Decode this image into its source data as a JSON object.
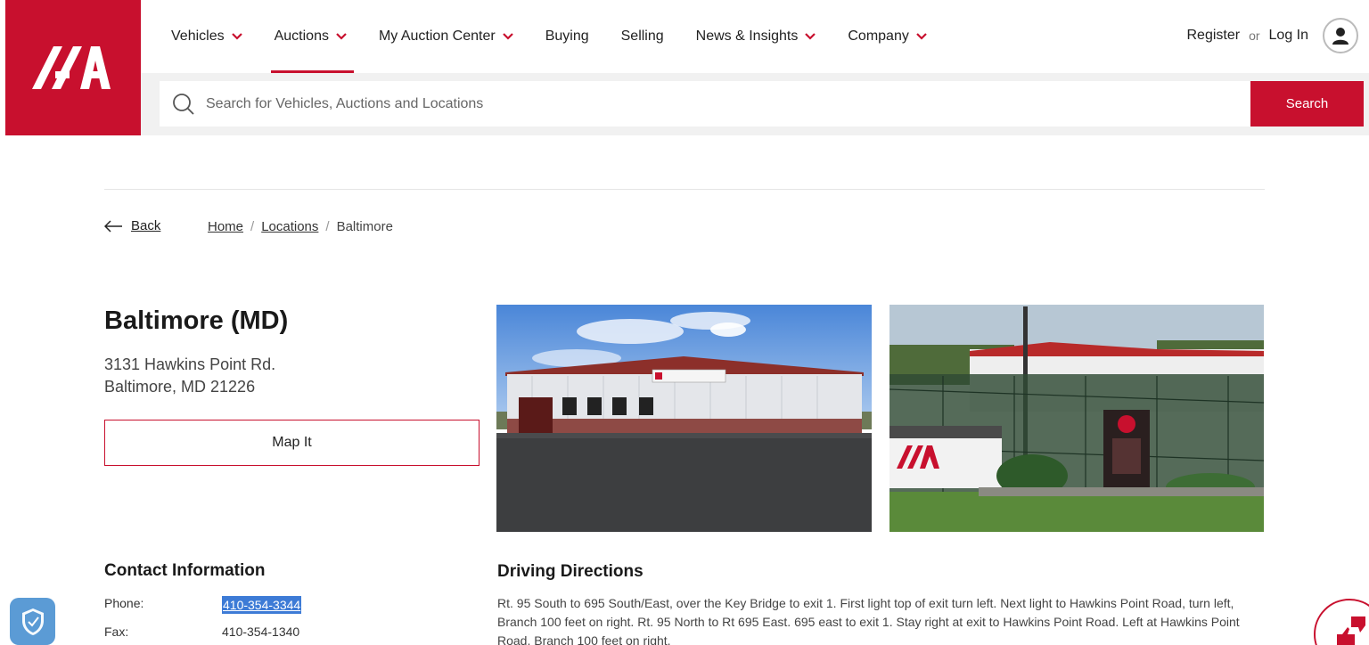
{
  "brand": {
    "accent": "#c8102e"
  },
  "nav": {
    "items": [
      {
        "label": "Vehicles",
        "dropdown": true
      },
      {
        "label": "Auctions",
        "dropdown": true,
        "active": true
      },
      {
        "label": "My Auction Center",
        "dropdown": true
      },
      {
        "label": "Buying",
        "dropdown": false
      },
      {
        "label": "Selling",
        "dropdown": false
      },
      {
        "label": "News & Insights",
        "dropdown": true
      },
      {
        "label": "Company",
        "dropdown": true
      }
    ],
    "register": "Register",
    "or": "or",
    "login": "Log In"
  },
  "search": {
    "placeholder": "Search for Vehicles, Auctions and Locations",
    "button": "Search"
  },
  "breadcrumb": {
    "back": "Back",
    "home": "Home",
    "locations": "Locations",
    "current": "Baltimore"
  },
  "location": {
    "title": "Baltimore (MD)",
    "address_line1": "3131 Hawkins Point Rd.",
    "address_line2": "Baltimore, MD 21226",
    "map_button": "Map It"
  },
  "contact": {
    "title": "Contact Information",
    "phone_label": "Phone:",
    "phone": "410-354-3344",
    "fax_label": "Fax:",
    "fax": "410-354-1340"
  },
  "directions": {
    "title": "Driving Directions",
    "text": "Rt. 95 South to 695 South/East, over the Key Bridge to exit 1. First light top of exit turn left. Next light to Hawkins Point Road, turn left, Branch 100 feet on right. Rt. 95 North to Rt 695 East. 695 east to exit 1. Stay right at exit to Hawkins Point Road. Left at Hawkins Point Road, Branch 100 feet on right."
  },
  "icons": {
    "logo": "iaa-logo",
    "search": "search-icon",
    "user": "user-icon",
    "back": "arrow-left-icon",
    "shield": "shield-check-icon",
    "feedback": "thumbs-icon"
  }
}
